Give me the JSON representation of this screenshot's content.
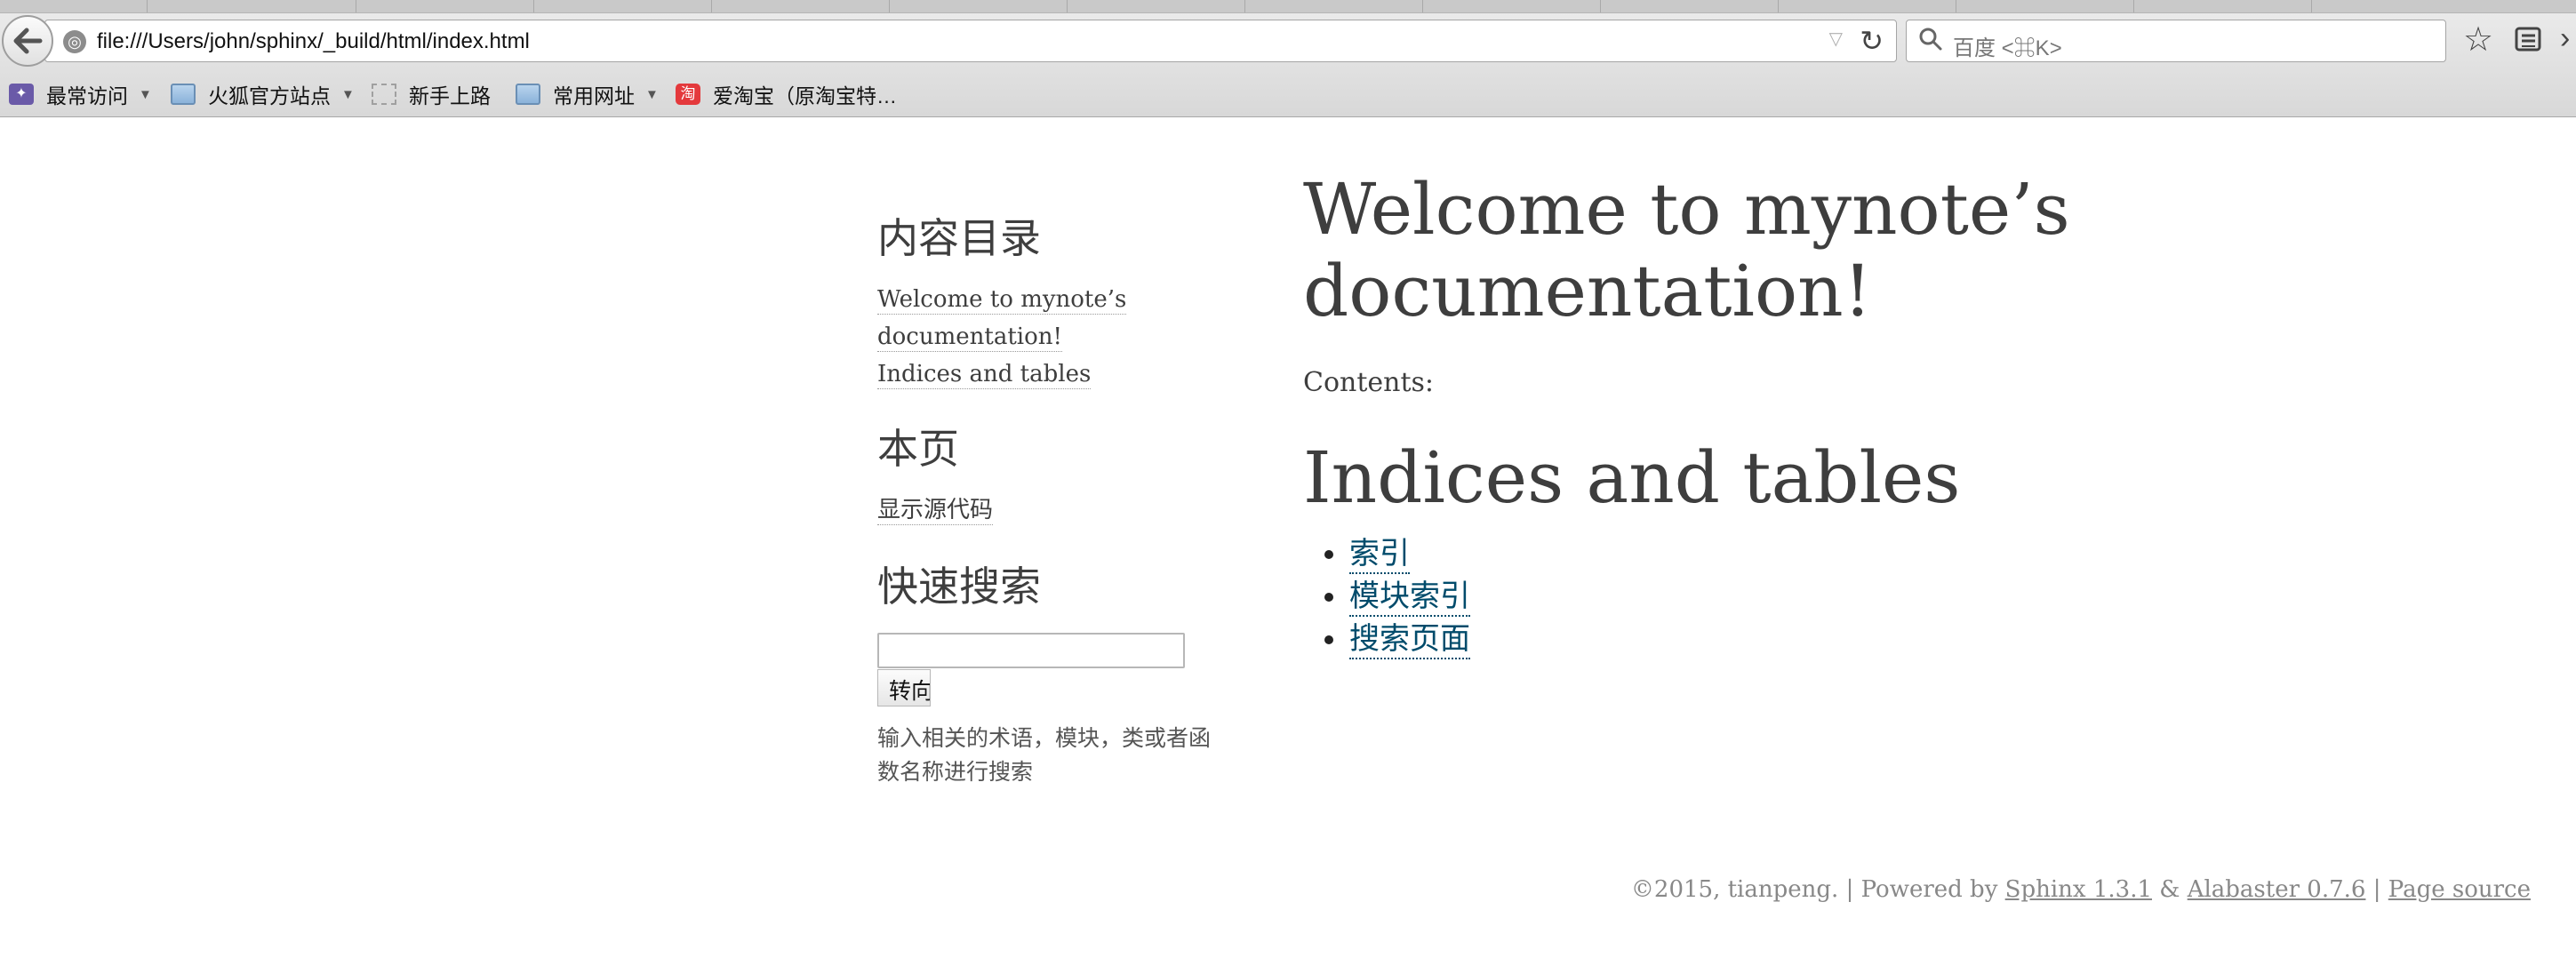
{
  "browser": {
    "url": "file:///Users/john/sphinx/_build/html/index.html",
    "search_placeholder": "百度 <⌘K>"
  },
  "bookmarks": [
    {
      "label": "最常访问",
      "icon": "most-visited-icon",
      "dropdown": true
    },
    {
      "label": "火狐官方站点",
      "icon": "folder-icon",
      "dropdown": true
    },
    {
      "label": "新手上路",
      "icon": "page-icon",
      "dropdown": false
    },
    {
      "label": "常用网址",
      "icon": "folder-icon",
      "dropdown": true
    },
    {
      "label": "爱淘宝（原淘宝特…",
      "icon": "taobao-icon",
      "dropdown": false
    }
  ],
  "sidebar": {
    "toc_heading": "内容目录",
    "toc_links": [
      "Welcome to mynote’s documentation!",
      "Indices and tables"
    ],
    "thispage_heading": "本页",
    "show_source": "显示源代码",
    "search_heading": "快速搜索",
    "go_button": "转向",
    "search_hint": "输入相关的术语，模块，类或者函数名称进行搜索"
  },
  "main": {
    "title": "Welcome to mynote’s documentation!",
    "contents_label": "Contents:",
    "indices_title": "Indices and tables",
    "links": [
      "索引",
      "模块索引",
      "搜索页面"
    ]
  },
  "footer": {
    "copyright": "©2015, tianpeng.",
    "powered_by": "Powered by",
    "sphinx": "Sphinx 1.3.1",
    "amp": "&",
    "alabaster": "Alabaster 0.7.6",
    "page_source": "Page source"
  },
  "colors": {
    "link": "#004b6b",
    "text": "#3e3e3e",
    "footer": "#888888"
  }
}
